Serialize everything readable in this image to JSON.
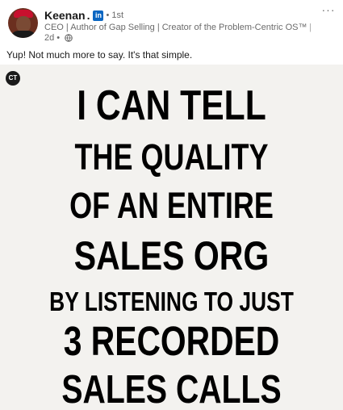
{
  "author": {
    "name": "Keenan",
    "name_suffix": ".",
    "linkedin_badge": "in",
    "degree": "1st",
    "headline": "CEO | Author of Gap Selling | Creator of the Problem-Centric OS™ | Driving Pr...",
    "time": "2d",
    "visibility_icon": "globe-icon",
    "avatar_icon": "avatar"
  },
  "menu": {
    "label": "···"
  },
  "post": {
    "text": "Yup! Not much more to say. It's that simple."
  },
  "image": {
    "logo_text": "CT",
    "lines": [
      "I CAN TELL",
      "THE QUALITY",
      "OF AN ENTIRE",
      "SALES ORG",
      "BY LISTENING TO JUST",
      "3 RECORDED",
      "SALES CALLS"
    ]
  },
  "colors": {
    "linkedin_blue": "#0a66c2",
    "image_background": "#f3f2ef",
    "text_secondary": "#666666"
  }
}
